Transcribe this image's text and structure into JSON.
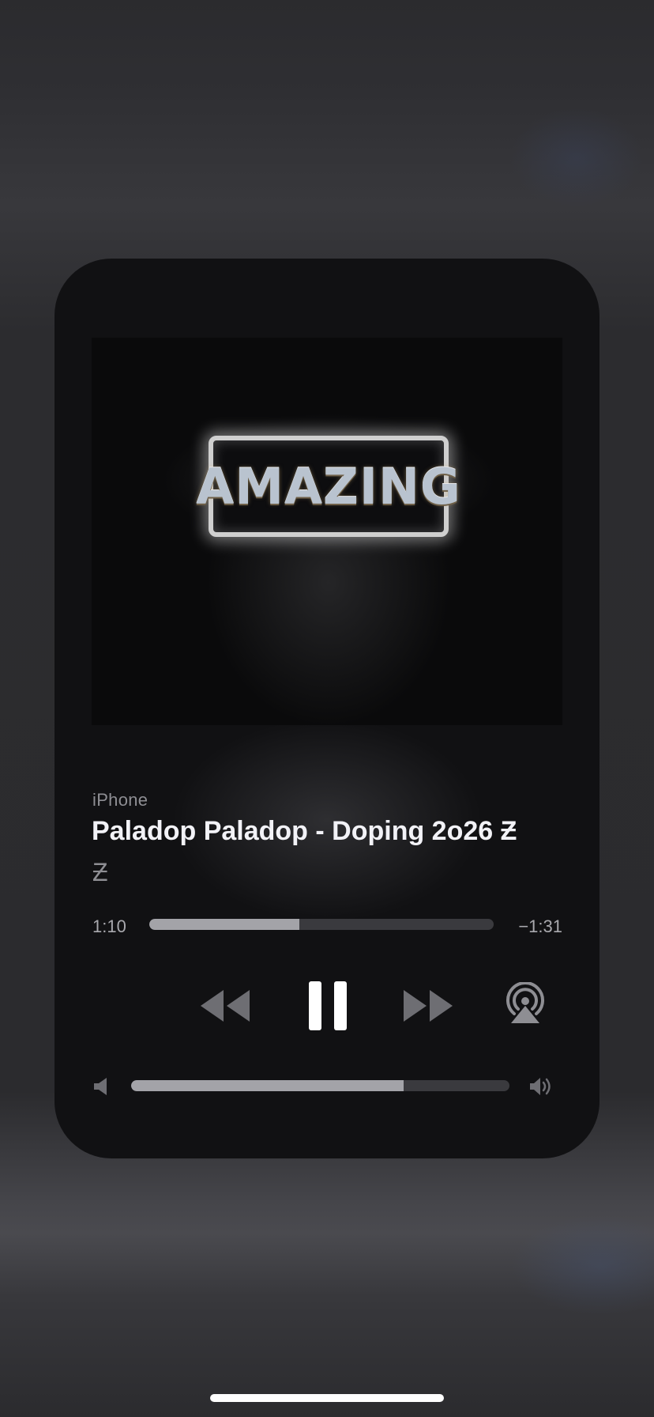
{
  "now_playing": {
    "artwork": {
      "sign_text": "AMAZING"
    },
    "device": "iPhone",
    "title": "Paladop Paladop - Doping 2o26 Ƶ",
    "artist": "Ƶ",
    "playback": {
      "elapsed": "1:10",
      "remaining": "−1:31",
      "progress_fraction": 0.435
    },
    "controls": {
      "rewind_icon": "rewind-icon",
      "pause_icon": "pause-icon",
      "forward_icon": "fast-forward-icon",
      "airplay_icon": "airplay-audio-icon"
    },
    "volume": {
      "level_fraction": 0.72,
      "low_icon": "speaker-low-icon",
      "high_icon": "speaker-high-icon"
    }
  },
  "colors": {
    "card_background": "#111113",
    "primary_text": "#f2f2f7",
    "secondary_text": "#8e8e93",
    "slider_fill": "#a3a3a8",
    "slider_track": "#3a3a3e"
  }
}
